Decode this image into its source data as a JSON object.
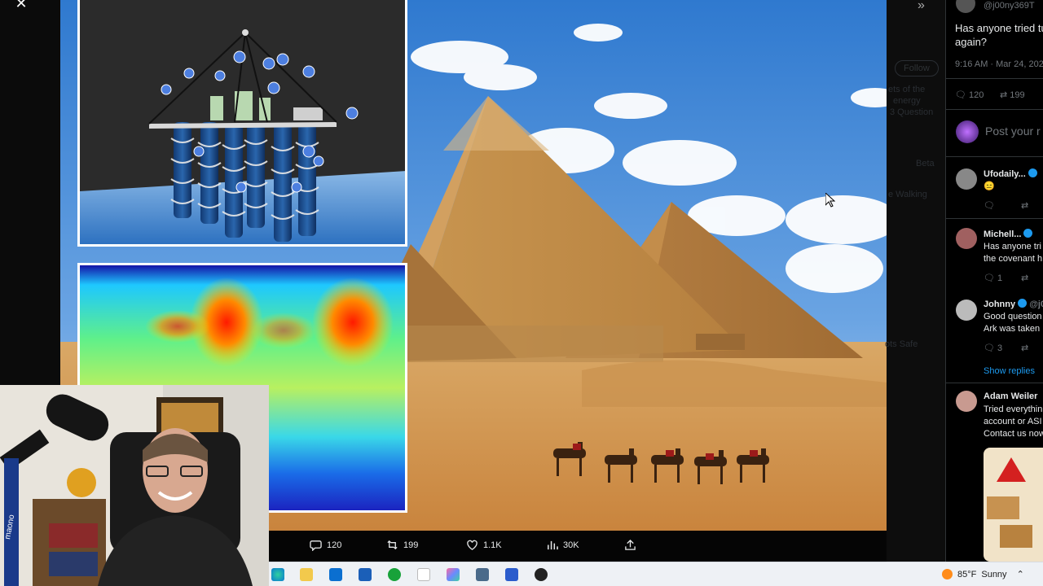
{
  "tweet": {
    "handle": "@j00ny369T",
    "text_line1": "Has anyone tried tu",
    "text_line2": "again?",
    "timestamp": "9:16 AM · Mar 24, 202",
    "replies": "120",
    "reposts": "199",
    "reply_placeholder": "Post your r"
  },
  "media_actions": {
    "replies": "120",
    "reposts": "199",
    "likes": "1.1K",
    "views": "30K"
  },
  "replies": [
    {
      "name": "Ufodaily...",
      "text_lines": [
        "😑"
      ],
      "reply_count": "",
      "repost_count": ""
    },
    {
      "name": "Michell...",
      "text_lines": [
        "Has anyone tri",
        "the covenant h"
      ],
      "reply_count": "1",
      "repost_count": ""
    },
    {
      "name": "Johnny",
      "handle": "@j0",
      "text_lines": [
        "Good question",
        "Ark was taken"
      ],
      "reply_count": "3",
      "repost_count": ""
    },
    {
      "name": "Adam Weiler",
      "text_lines": [
        "Tried everythin",
        "account or ASI",
        "Contact us now"
      ]
    }
  ],
  "show_replies": "Show replies",
  "ghost": {
    "follow": "Follow",
    "line1": "ets of the",
    "line2": "energy",
    "line3": "3 Question",
    "beta": "Beta",
    "walking": "e Walking",
    "safe": "ots Safe"
  },
  "taskbar": {
    "temperature": "85°F",
    "condition": "Sunny"
  },
  "webcam": {
    "mic_brand": "maono"
  },
  "colors": {
    "accent": "#1d9bf0",
    "sky": "#4d8fd6",
    "sand": "#d8a25e"
  }
}
